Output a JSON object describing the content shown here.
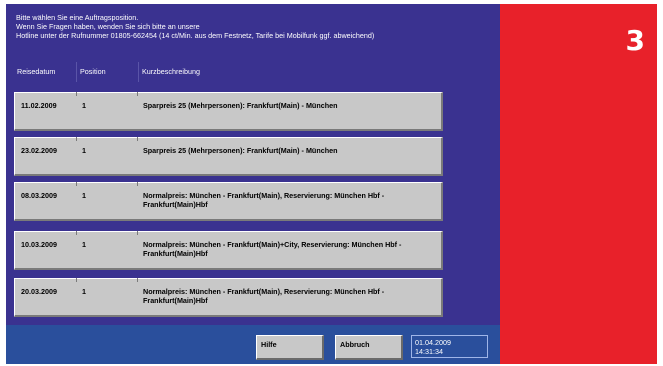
{
  "step_number": "3",
  "header": {
    "line1": "Bitte wählen Sie eine Auftragsposition.",
    "line2": "Wenn Sie Fragen haben, wenden Sie sich bitte an unsere",
    "line3": "Hotline unter der Rufnummer 01805-662454 (14 ct/Min. aus dem Festnetz, Tarife bei Mobilfunk ggf. abweichend)"
  },
  "columns": {
    "date": "Reisedatum",
    "position": "Position",
    "description": "Kurzbeschreibung"
  },
  "rows": [
    {
      "date": "11.02.2009",
      "position": "1",
      "description": "Sparpreis 25 (Mehrpersonen): Frankfurt(Main) - München"
    },
    {
      "date": "23.02.2009",
      "position": "1",
      "description": "Sparpreis 25 (Mehrpersonen): Frankfurt(Main) - München"
    },
    {
      "date": "08.03.2009",
      "position": "1",
      "description": "Normalpreis: München - Frankfurt(Main), Reservierung: München Hbf - Frankfurt(Main)Hbf"
    },
    {
      "date": "10.03.2009",
      "position": "1",
      "description": "Normalpreis: München - Frankfurt(Main)+City, Reservierung: München Hbf - Frankfurt(Main)Hbf"
    },
    {
      "date": "20.03.2009",
      "position": "1",
      "description": "Normalpreis: München - Frankfurt(Main), Reservierung: München Hbf - Frankfurt(Main)Hbf"
    }
  ],
  "footer": {
    "help_label": "Hilfe",
    "cancel_label": "Abbruch",
    "date": "01.04.2009",
    "time": "14:31:34"
  },
  "colors": {
    "background": "#3a3290",
    "accent_panel": "#e8212a",
    "footer_bar": "#2a4f9c",
    "row": "#c8c8c8"
  }
}
